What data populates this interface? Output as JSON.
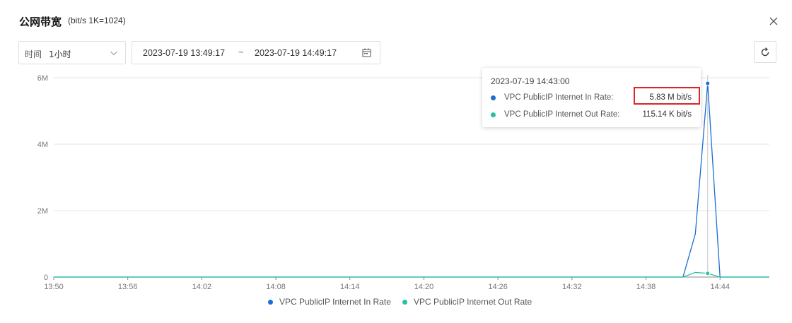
{
  "dialog": {
    "title": "公网带宽",
    "subtitle": "(bit/s  1K=1024)"
  },
  "toolbar": {
    "time_label": "时间",
    "time_value": "1小时",
    "start": "2023-07-19 13:49:17",
    "separator": "~",
    "end": "2023-07-19 14:49:17"
  },
  "icons": {
    "close": "close-icon",
    "chevron": "chevron-down-icon",
    "calendar": "calendar-icon",
    "refresh": "refresh-icon"
  },
  "colors": {
    "in": "#1a6fcf",
    "out": "#27c2a0",
    "grid": "#e4e4e4",
    "highlight": "#d9252b"
  },
  "tooltip": {
    "time": "2023-07-19 14:43:00",
    "rows": [
      {
        "name": "VPC PublicIP Internet In Rate:",
        "value": "5.83 M bit/s",
        "color": "#1a6fcf"
      },
      {
        "name": "VPC PublicIP Internet Out Rate:",
        "value": "115.14 K bit/s",
        "color": "#27c2a0"
      }
    ]
  },
  "chart_data": {
    "type": "line",
    "x_ticks": [
      "13:50",
      "13:56",
      "14:02",
      "14:08",
      "14:14",
      "14:20",
      "14:26",
      "14:32",
      "14:38",
      "14:44"
    ],
    "y_ticks": [
      "0",
      "2M",
      "4M",
      "6M"
    ],
    "xlim_minutes_from_1350": [
      0,
      58
    ],
    "ylim": [
      0,
      6
    ],
    "grid": true,
    "legend": "bottom",
    "series": [
      {
        "name": "VPC PublicIP Internet In Rate",
        "unit": "M bit/s",
        "color": "#1a6fcf",
        "points": [
          [
            0,
            0
          ],
          [
            51,
            0
          ],
          [
            52,
            1.3
          ],
          [
            53,
            5.83
          ],
          [
            54,
            0
          ],
          [
            58,
            0
          ]
        ]
      },
      {
        "name": "VPC PublicIP Internet Out Rate",
        "unit": "M bit/s",
        "color": "#27c2a0",
        "points": [
          [
            0,
            0
          ],
          [
            51,
            0
          ],
          [
            52,
            0.14
          ],
          [
            53,
            0.112
          ],
          [
            54,
            0
          ],
          [
            58,
            0
          ]
        ]
      }
    ],
    "active_x": 53
  }
}
